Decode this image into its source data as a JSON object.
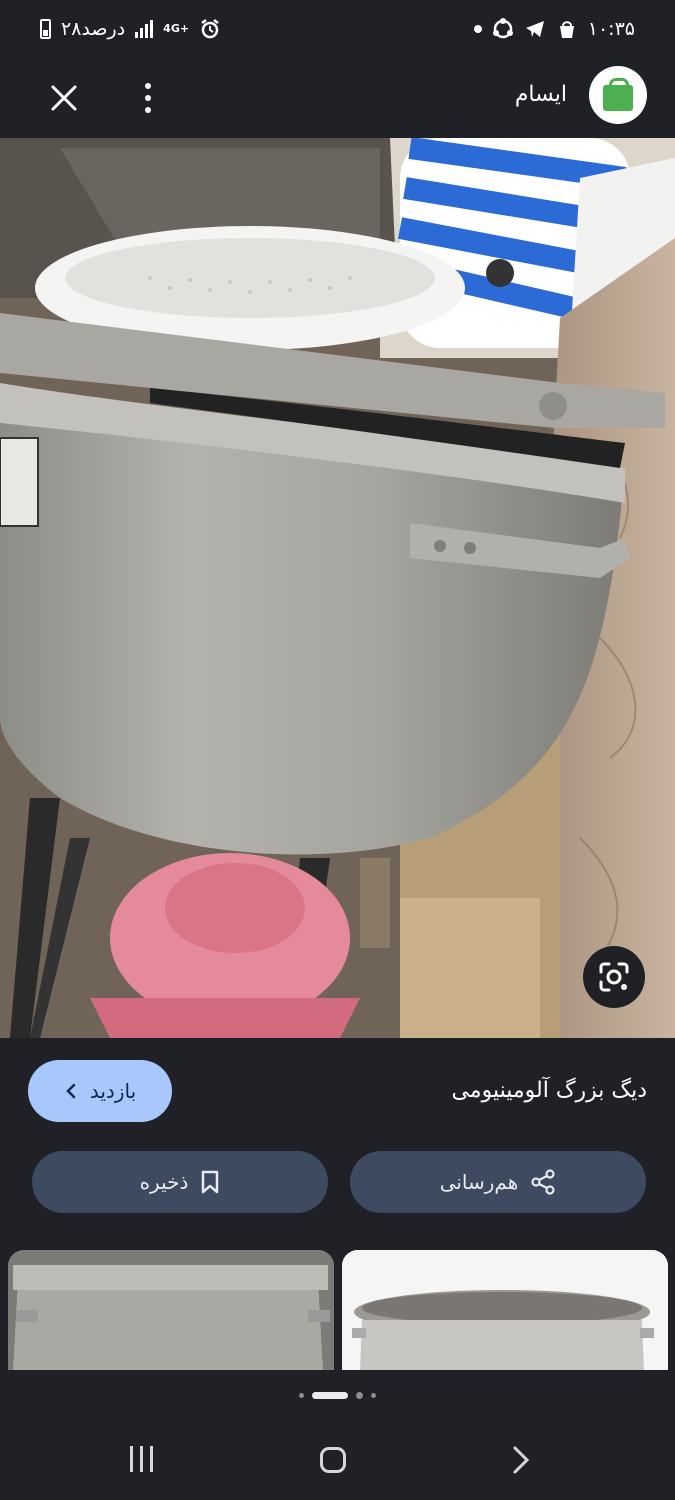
{
  "status_bar": {
    "time": "۱۰:۳۵",
    "battery_text": "۲۸درصد",
    "network": "4G+"
  },
  "top_bar": {
    "site_name": "ایسام",
    "close_icon": "close-icon",
    "more_icon": "more-vert-icon"
  },
  "product": {
    "title": "دیگ بزرگ آلومینیومی"
  },
  "actions": {
    "visit_label": "بازدید",
    "save_label": "ذخیره",
    "share_label": "هم‌رسانی"
  },
  "colors": {
    "background": "#1f2127",
    "visit_button": "#a8c7fa",
    "pill_button": "#3e4a60",
    "logo_green": "#4caf50"
  },
  "pager": {
    "pages": 4,
    "active_index": 1
  }
}
